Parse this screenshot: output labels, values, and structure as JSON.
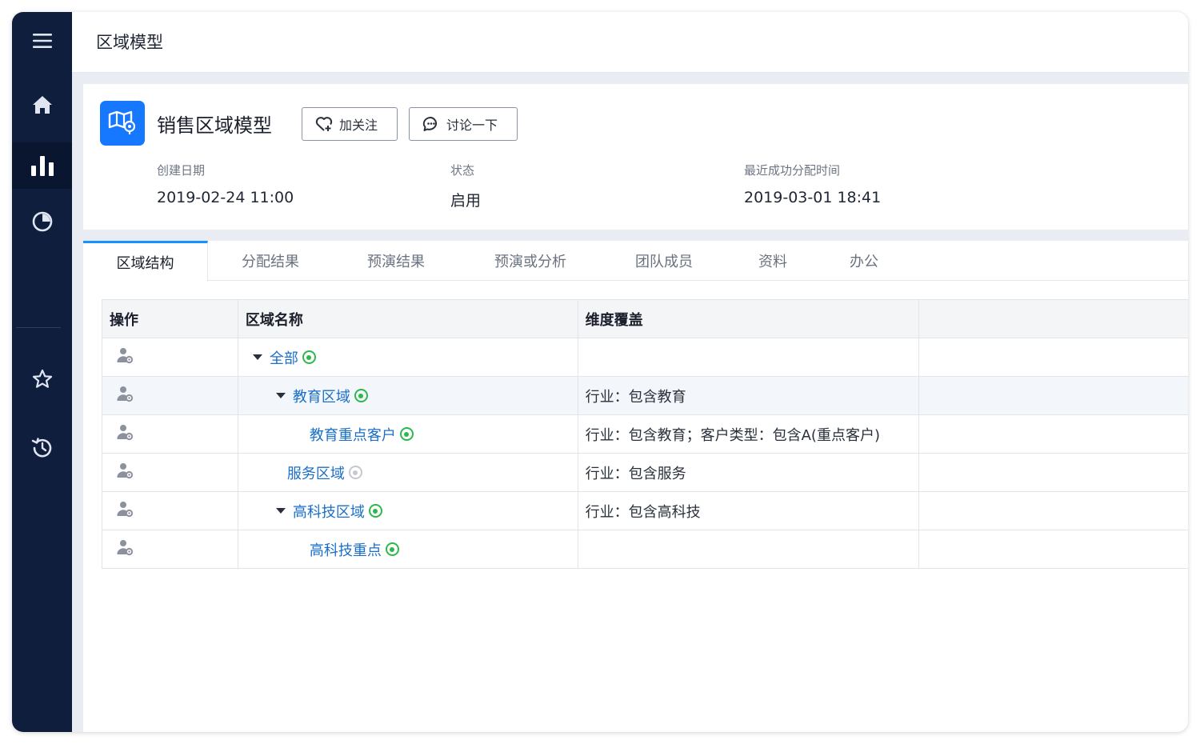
{
  "sidebar": {
    "items": [
      {
        "icon": "menu-icon"
      },
      {
        "icon": "home-icon"
      },
      {
        "icon": "bar-chart-icon",
        "active": true
      },
      {
        "icon": "pie-chart-icon"
      },
      {
        "icon": "star-icon"
      },
      {
        "icon": "history-icon"
      }
    ]
  },
  "header": {
    "title": "区域模型"
  },
  "model": {
    "icon": "map-icon",
    "title": "销售区域模型",
    "follow_label": "加关注",
    "discuss_label": "讨论一下",
    "meta": [
      {
        "label": "创建日期",
        "value": "2019-02-24 11:00"
      },
      {
        "label": "状态",
        "value": "启用"
      },
      {
        "label": "最近成功分配时间",
        "value": "2019-03-01 18:41"
      }
    ]
  },
  "tabs": [
    {
      "label": "区域结构",
      "active": true
    },
    {
      "label": "分配结果"
    },
    {
      "label": "预演结果"
    },
    {
      "label": "预演或分析"
    },
    {
      "label": "团队成员"
    },
    {
      "label": "资料"
    },
    {
      "label": "办公"
    }
  ],
  "table": {
    "headers": [
      "操作",
      "区域名称",
      "维度覆盖",
      ""
    ],
    "rows": [
      {
        "name": "全部",
        "coverage": "",
        "expanded": true,
        "enabled": true
      },
      {
        "name": "教育区域",
        "coverage": "行业：包含教育",
        "expanded": true,
        "enabled": true
      },
      {
        "name": "教育重点客户",
        "coverage": "行业：包含教育；客户类型：包含A(重点客户)",
        "enabled": true
      },
      {
        "name": "服务区域",
        "coverage": "行业：包含服务",
        "enabled": false
      },
      {
        "name": "高科技区域",
        "coverage": "行业：包含高科技",
        "expanded": true,
        "enabled": true
      },
      {
        "name": "高科技重点",
        "coverage": "",
        "enabled": true
      }
    ]
  },
  "colors": {
    "sidebar": "#0f1e3d",
    "accent": "#1677ff",
    "link": "#1a6fc8",
    "status_on": "#2db84d",
    "status_off": "#c4c8cf"
  }
}
